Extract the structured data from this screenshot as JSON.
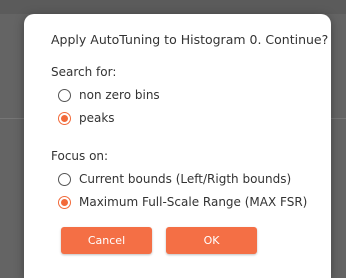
{
  "dialog": {
    "message": "Apply AutoTuning to Histogram 0. Continue?",
    "search_group": {
      "label": "Search for:",
      "options": [
        {
          "label": "non zero bins",
          "checked": false
        },
        {
          "label": "peaks",
          "checked": true
        }
      ]
    },
    "focus_group": {
      "label": "Focus on:",
      "options": [
        {
          "label": "Current bounds (Left/Rigth bounds)",
          "checked": false
        },
        {
          "label": "Maximum Full-Scale Range (MAX FSR)",
          "checked": true
        }
      ]
    },
    "buttons": {
      "cancel_label": "Cancel",
      "ok_label": "OK"
    }
  },
  "colors": {
    "accent": "#f46f45",
    "overlay": "#646464"
  }
}
